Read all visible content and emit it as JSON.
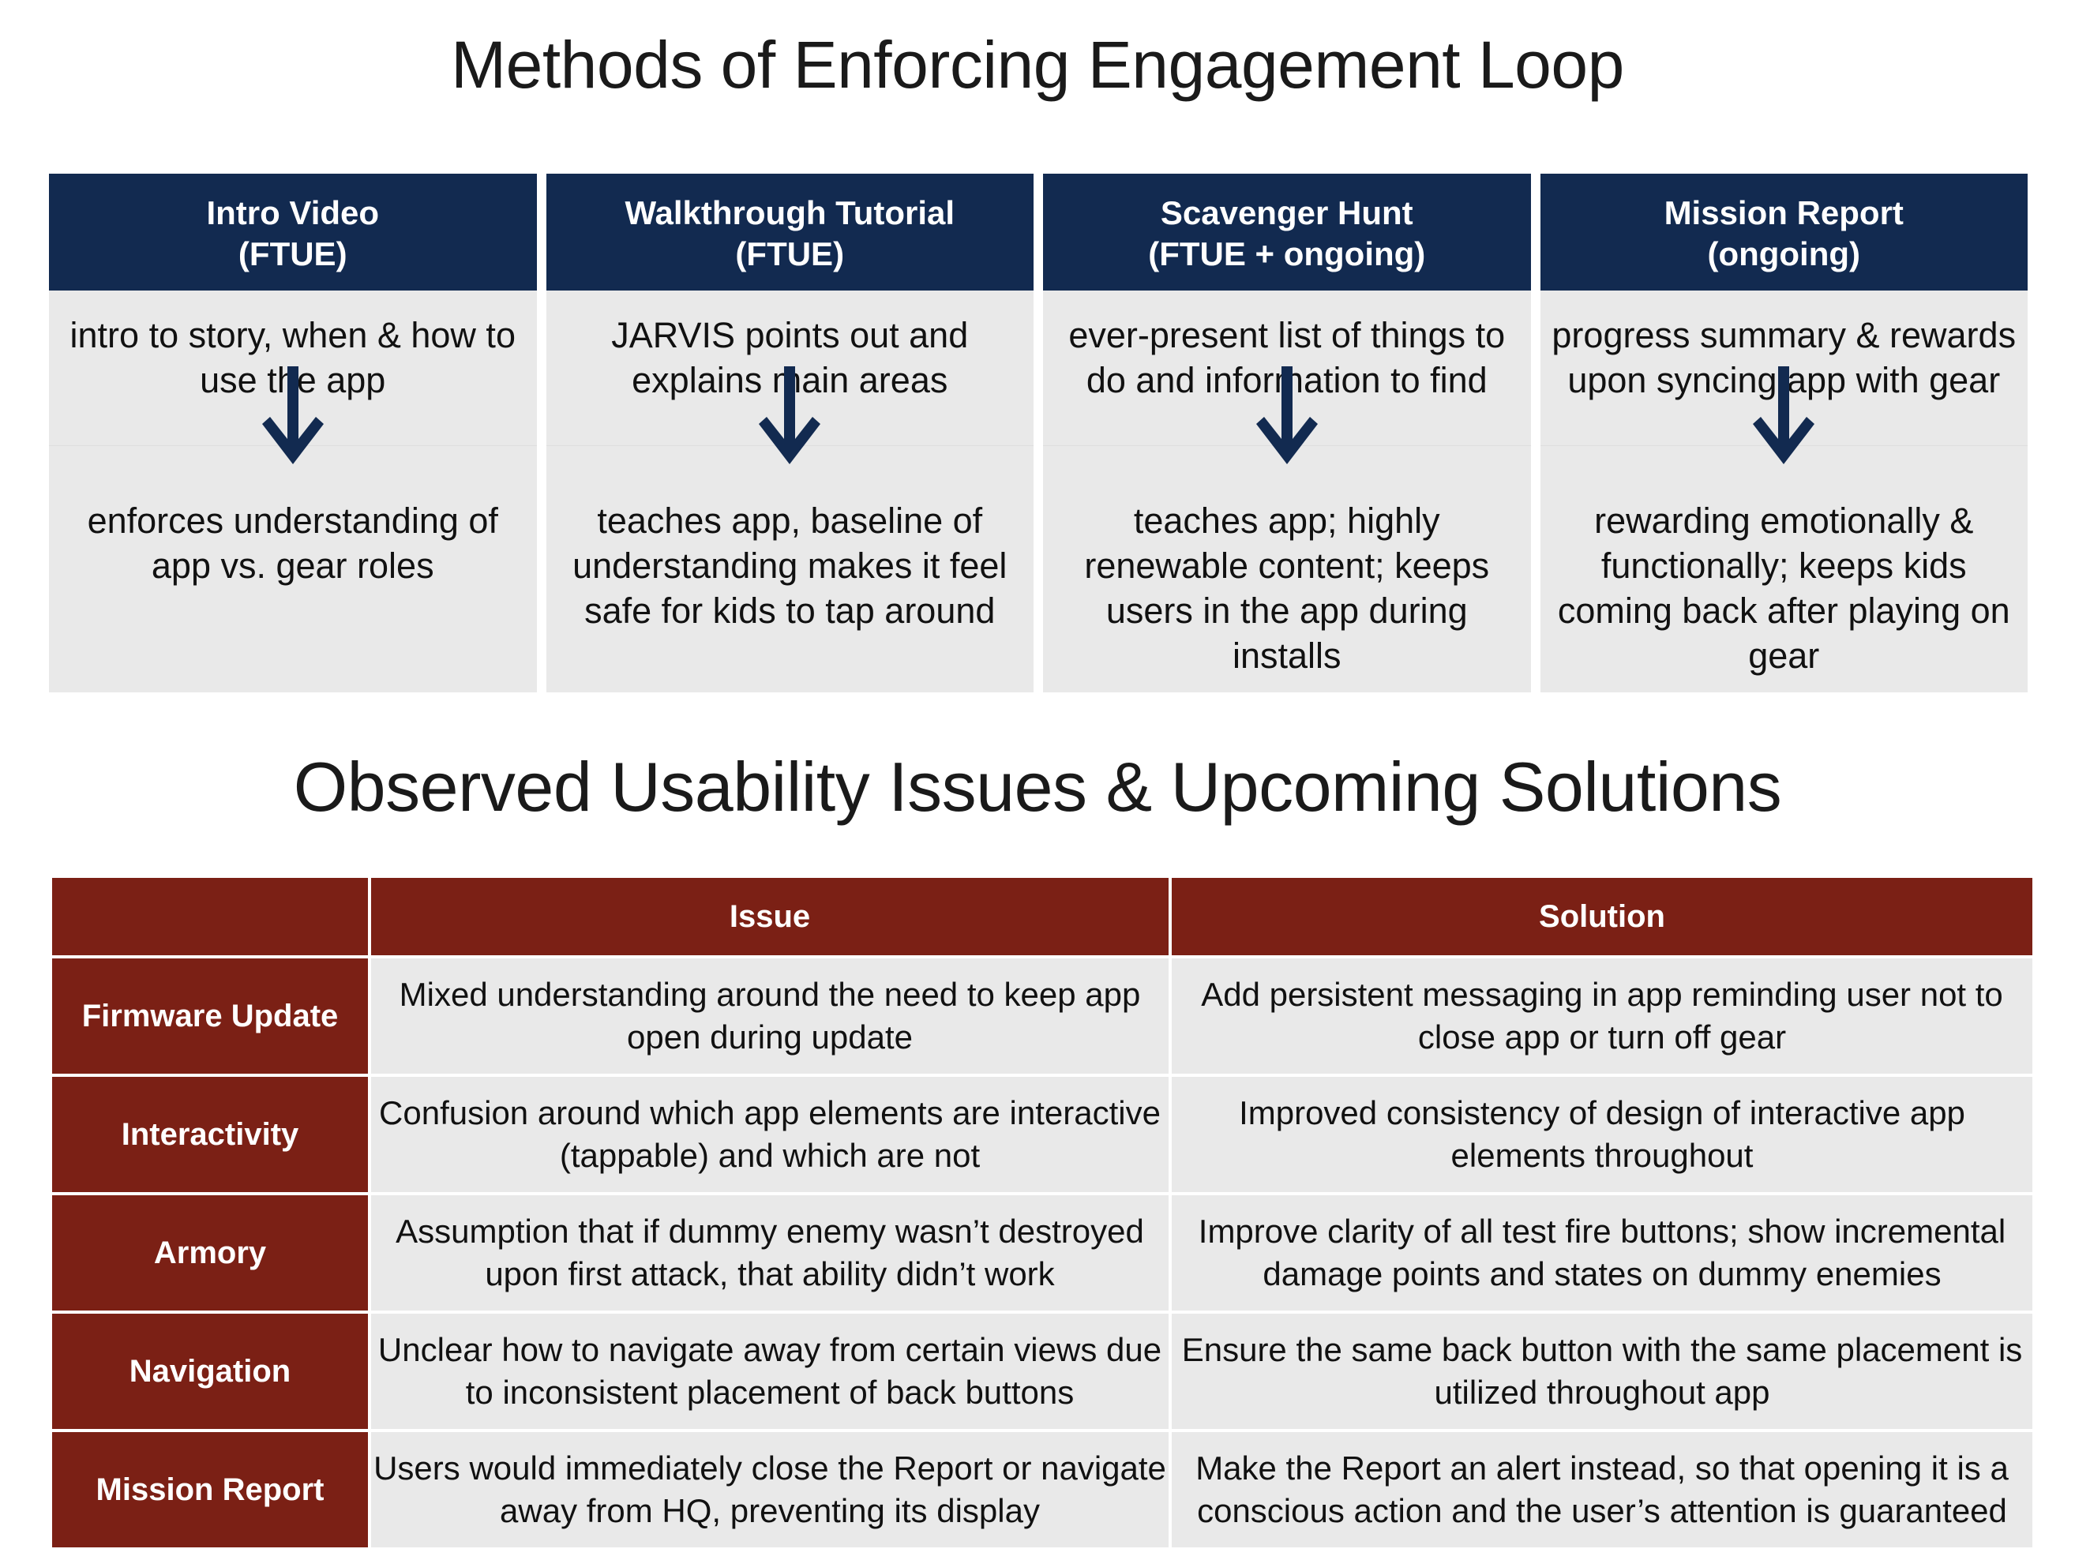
{
  "colors": {
    "navy": "#122a50",
    "dark_red": "#7b2015",
    "cell_gray": "#e9e9e9",
    "page_background": "#ffffff",
    "text": "#111111"
  },
  "section_loop": {
    "title": "Methods of Enforcing Engagement Loop",
    "columns": [
      {
        "header_line1": "Intro Video",
        "header_line2": "(FTUE)",
        "top": "intro to story, when & how to use the app",
        "arrow": "down-arrow",
        "bottom": "enforces understanding of app vs. gear roles"
      },
      {
        "header_line1": "Walkthrough Tutorial",
        "header_line2": "(FTUE)",
        "top": "JARVIS points out and explains main areas",
        "arrow": "down-arrow",
        "bottom": "teaches app, baseline of understanding makes it feel safe for kids to tap around"
      },
      {
        "header_line1": "Scavenger Hunt",
        "header_line2": "(FTUE + ongoing)",
        "top": "ever-present list of things to do and information to find",
        "arrow": "down-arrow",
        "bottom": "teaches app; highly renewable content; keeps users in the app during installs"
      },
      {
        "header_line1": "Mission Report",
        "header_line2": "(ongoing)",
        "top": "progress summary & rewards upon syncing app with gear",
        "arrow": "down-arrow",
        "bottom": "rewarding emotionally & functionally; keeps kids coming back after playing on gear"
      }
    ]
  },
  "section_issues": {
    "title": "Observed Usability Issues & Upcoming Solutions",
    "headers": {
      "corner": "",
      "issue": "Issue",
      "solution": "Solution"
    },
    "rows": [
      {
        "label": "Firmware Update",
        "issue": "Mixed understanding around the need to keep app open during update",
        "solution": "Add persistent messaging in app reminding user not to close app or turn off gear"
      },
      {
        "label": "Interactivity",
        "issue": "Confusion around which app elements are interactive (tappable) and which are not",
        "solution": "Improved consistency of design of interactive app elements throughout"
      },
      {
        "label": "Armory",
        "issue": "Assumption that if dummy enemy wasn’t destroyed upon first attack, that ability didn’t work",
        "solution": "Improve clarity of all test fire buttons; show incremental damage points and states on dummy enemies"
      },
      {
        "label": "Navigation",
        "issue": "Unclear how to navigate away from certain views due to inconsistent placement of back buttons",
        "solution": "Ensure the same back button with the same placement is utilized throughout app"
      },
      {
        "label": "Mission Report",
        "issue": "Users would immediately close the Report or navigate away from HQ, preventing its display",
        "solution": "Make the Report an alert instead, so that opening it is a conscious action and the user’s attention is guaranteed"
      }
    ]
  }
}
